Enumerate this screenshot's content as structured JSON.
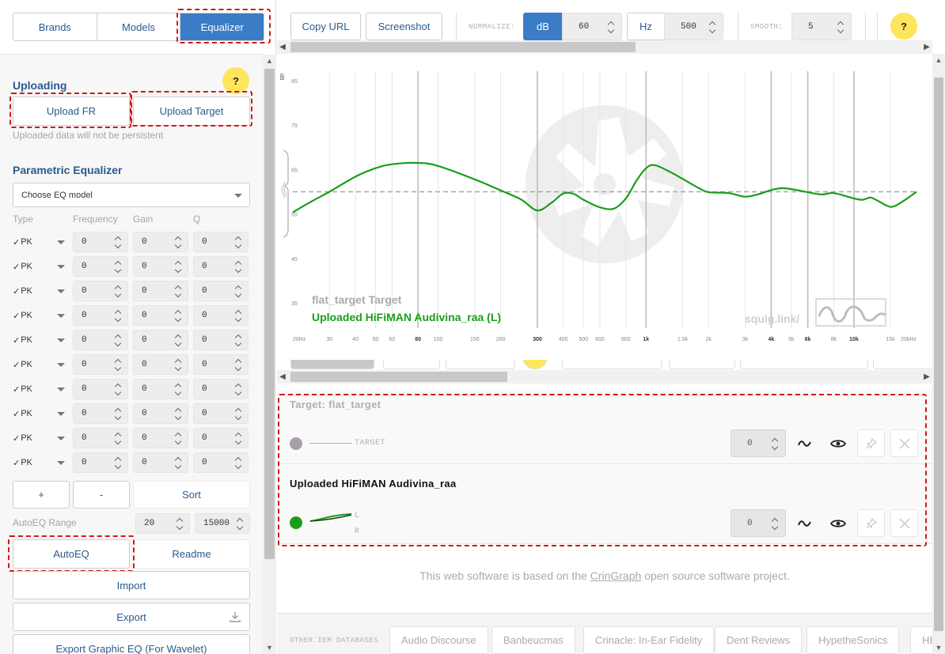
{
  "nav_tabs": [
    {
      "label": "Brands"
    },
    {
      "label": "Models"
    },
    {
      "label": "Equalizer"
    }
  ],
  "uploading": {
    "title": "Uploading",
    "help": "?",
    "upload_fr": "Upload FR",
    "upload_target": "Upload Target",
    "note": "Uploaded data will not be persistent"
  },
  "peq": {
    "title": "Parametric Equalizer",
    "model_select": "Choose EQ model",
    "headers": {
      "type": "Type",
      "frequency": "Frequency",
      "gain": "Gain",
      "q": "Q"
    },
    "filters": [
      {
        "check": "✓",
        "type": "PK",
        "freq": "0",
        "gain": "0",
        "q": "0"
      },
      {
        "check": "✓",
        "type": "PK",
        "freq": "0",
        "gain": "0",
        "q": "0"
      },
      {
        "check": "✓",
        "type": "PK",
        "freq": "0",
        "gain": "0",
        "q": "0"
      },
      {
        "check": "✓",
        "type": "PK",
        "freq": "0",
        "gain": "0",
        "q": "0"
      },
      {
        "check": "✓",
        "type": "PK",
        "freq": "0",
        "gain": "0",
        "q": "0"
      },
      {
        "check": "✓",
        "type": "PK",
        "freq": "0",
        "gain": "0",
        "q": "0"
      },
      {
        "check": "✓",
        "type": "PK",
        "freq": "0",
        "gain": "0",
        "q": "0"
      },
      {
        "check": "✓",
        "type": "PK",
        "freq": "0",
        "gain": "0",
        "q": "0"
      },
      {
        "check": "✓",
        "type": "PK",
        "freq": "0",
        "gain": "0",
        "q": "0"
      },
      {
        "check": "✓",
        "type": "PK",
        "freq": "0",
        "gain": "0",
        "q": "0"
      }
    ],
    "add": "+",
    "remove": "-",
    "sort": "Sort",
    "autoeq_range_label": "AutoEQ Range",
    "autoeq_range_min": "20",
    "autoeq_range_max": "15000",
    "autoeq": "AutoEQ",
    "readme": "Readme",
    "import": "Import",
    "export": "Export",
    "export_graphic": "Export Graphic EQ (For Wavelet)"
  },
  "toolbar": {
    "copy_url": "Copy URL",
    "screenshot": "Screenshot",
    "normalize_label": "NORMALIZE:",
    "db_button": "dB",
    "db_value": "60",
    "hz_button": "Hz",
    "hz_value": "500",
    "smooth_label": "SMOOTH:",
    "smooth_value": "5",
    "help": "?"
  },
  "graph": {
    "y_unit": "dB",
    "y_ticks": [
      "85",
      "75",
      "65",
      "55",
      "45",
      "35"
    ],
    "x_ticks": [
      {
        "hz": 20,
        "label": "20Hz",
        "bold": false
      },
      {
        "hz": 30,
        "label": "30",
        "bold": false
      },
      {
        "hz": 40,
        "label": "40",
        "bold": false
      },
      {
        "hz": 50,
        "label": "50",
        "bold": false
      },
      {
        "hz": 60,
        "label": "60",
        "bold": false
      },
      {
        "hz": 80,
        "label": "80",
        "bold": true
      },
      {
        "hz": 100,
        "label": "100",
        "bold": false
      },
      {
        "hz": 150,
        "label": "150",
        "bold": false
      },
      {
        "hz": 200,
        "label": "200",
        "bold": false
      },
      {
        "hz": 300,
        "label": "300",
        "bold": true
      },
      {
        "hz": 400,
        "label": "400",
        "bold": false
      },
      {
        "hz": 500,
        "label": "500",
        "bold": false
      },
      {
        "hz": 600,
        "label": "600",
        "bold": false
      },
      {
        "hz": 800,
        "label": "800",
        "bold": false
      },
      {
        "hz": 1000,
        "label": "1k",
        "bold": true
      },
      {
        "hz": 1500,
        "label": "1.5k",
        "bold": false
      },
      {
        "hz": 2000,
        "label": "2k",
        "bold": false
      },
      {
        "hz": 3000,
        "label": "3k",
        "bold": false
      },
      {
        "hz": 4000,
        "label": "4k",
        "bold": true
      },
      {
        "hz": 5000,
        "label": "5k",
        "bold": false
      },
      {
        "hz": 6000,
        "label": "6k",
        "bold": true
      },
      {
        "hz": 8000,
        "label": "8k",
        "bold": false
      },
      {
        "hz": 10000,
        "label": "10k",
        "bold": true
      },
      {
        "hz": 15000,
        "label": "15k",
        "bold": false
      },
      {
        "hz": 20000,
        "label": "20kHz",
        "bold": false
      }
    ],
    "legend_target": "flat_target Target",
    "legend_uploaded": "Uploaded HiFiMAN Audivina_raa (L)",
    "watermark": "squig.link/",
    "target_level_db": 60,
    "curve": [
      [
        20,
        55.4
      ],
      [
        25,
        58
      ],
      [
        30,
        60
      ],
      [
        40,
        63.4
      ],
      [
        50,
        65.3
      ],
      [
        60,
        66.2
      ],
      [
        80,
        66.5
      ],
      [
        100,
        65.8
      ],
      [
        150,
        62.8
      ],
      [
        200,
        60.3
      ],
      [
        250,
        58.3
      ],
      [
        300,
        55.8
      ],
      [
        350,
        57.5
      ],
      [
        400,
        59.6
      ],
      [
        450,
        59.5
      ],
      [
        500,
        58.2
      ],
      [
        600,
        56.5
      ],
      [
        700,
        56.2
      ],
      [
        800,
        58.5
      ],
      [
        900,
        62.5
      ],
      [
        1000,
        65.3
      ],
      [
        1100,
        66
      ],
      [
        1300,
        64.5
      ],
      [
        1500,
        62.9
      ],
      [
        1800,
        60.8
      ],
      [
        2000,
        59.9
      ],
      [
        2500,
        59.7
      ],
      [
        3000,
        58.9
      ],
      [
        3500,
        59.5
      ],
      [
        4000,
        60.4
      ],
      [
        4500,
        60.8
      ],
      [
        5000,
        60.6
      ],
      [
        6000,
        59.9
      ],
      [
        7000,
        59.4
      ],
      [
        8000,
        59.7
      ],
      [
        10000,
        58.5
      ],
      [
        11000,
        58.2
      ],
      [
        12000,
        58.7
      ],
      [
        13000,
        58
      ],
      [
        15000,
        56.6
      ],
      [
        17000,
        57.7
      ],
      [
        20000,
        60
      ]
    ]
  },
  "phones": {
    "target_title_prefix": "Target:",
    "target_title": "flat_target",
    "target_tag": "TARGET",
    "target_offset": "0",
    "uploaded_title_prefix": "Uploaded",
    "uploaded_title": "HiFiMAN Audivina_raa",
    "channel_l": "L",
    "channel_r": "R",
    "uploaded_offset": "0",
    "target_color": "#a8a0a8",
    "uploaded_color": "#1a9f1a"
  },
  "footer": {
    "prefix": "This web software is based on the",
    "link": "CrinGraph",
    "suffix": "open source software project."
  },
  "databases": {
    "label": "OTHER IEM DATABASES",
    "items": [
      "Audio Discourse",
      "Banbeucmas",
      "Crinacle: In-Ear Fidelity",
      "Dent Reviews",
      "HypetheSonics",
      "HE"
    ]
  },
  "colors": {
    "accent": "#3a7cc6",
    "link_text": "#2a5b8c",
    "highlight_dash": "#d01919",
    "help_yellow": "#ffe55c"
  }
}
